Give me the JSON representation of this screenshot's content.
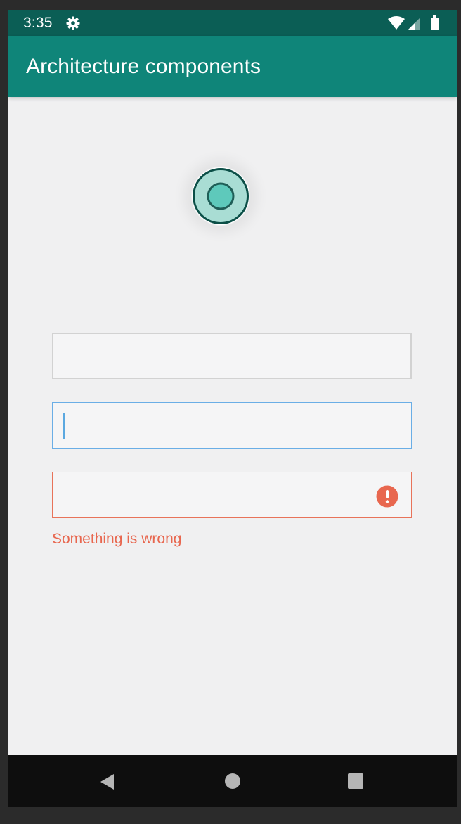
{
  "status_bar": {
    "time": "3:35",
    "icons": [
      "gear-icon",
      "wifi-icon",
      "cellular-signal-icon",
      "battery-icon"
    ],
    "color": "#0b5e55"
  },
  "app_bar": {
    "title": "Architecture components",
    "color": "#0f8579"
  },
  "logo": {
    "icon": "app-logo-icon",
    "colors": {
      "ring": "#0b4f47",
      "fill": "#a9ddd4",
      "center": "#5ec9bb"
    }
  },
  "form": {
    "fields": [
      {
        "value": "",
        "placeholder": "",
        "state": "default"
      },
      {
        "value": "",
        "placeholder": "",
        "state": "focused"
      },
      {
        "value": "",
        "placeholder": "",
        "state": "error"
      }
    ],
    "error_message": "Something is wrong",
    "colors": {
      "focused_border": "#6aaee6",
      "error": "#e8674f",
      "default_border": "#d2d2d2"
    }
  },
  "nav_bar": {
    "buttons": [
      "back-icon",
      "home-icon",
      "recents-icon"
    ]
  }
}
